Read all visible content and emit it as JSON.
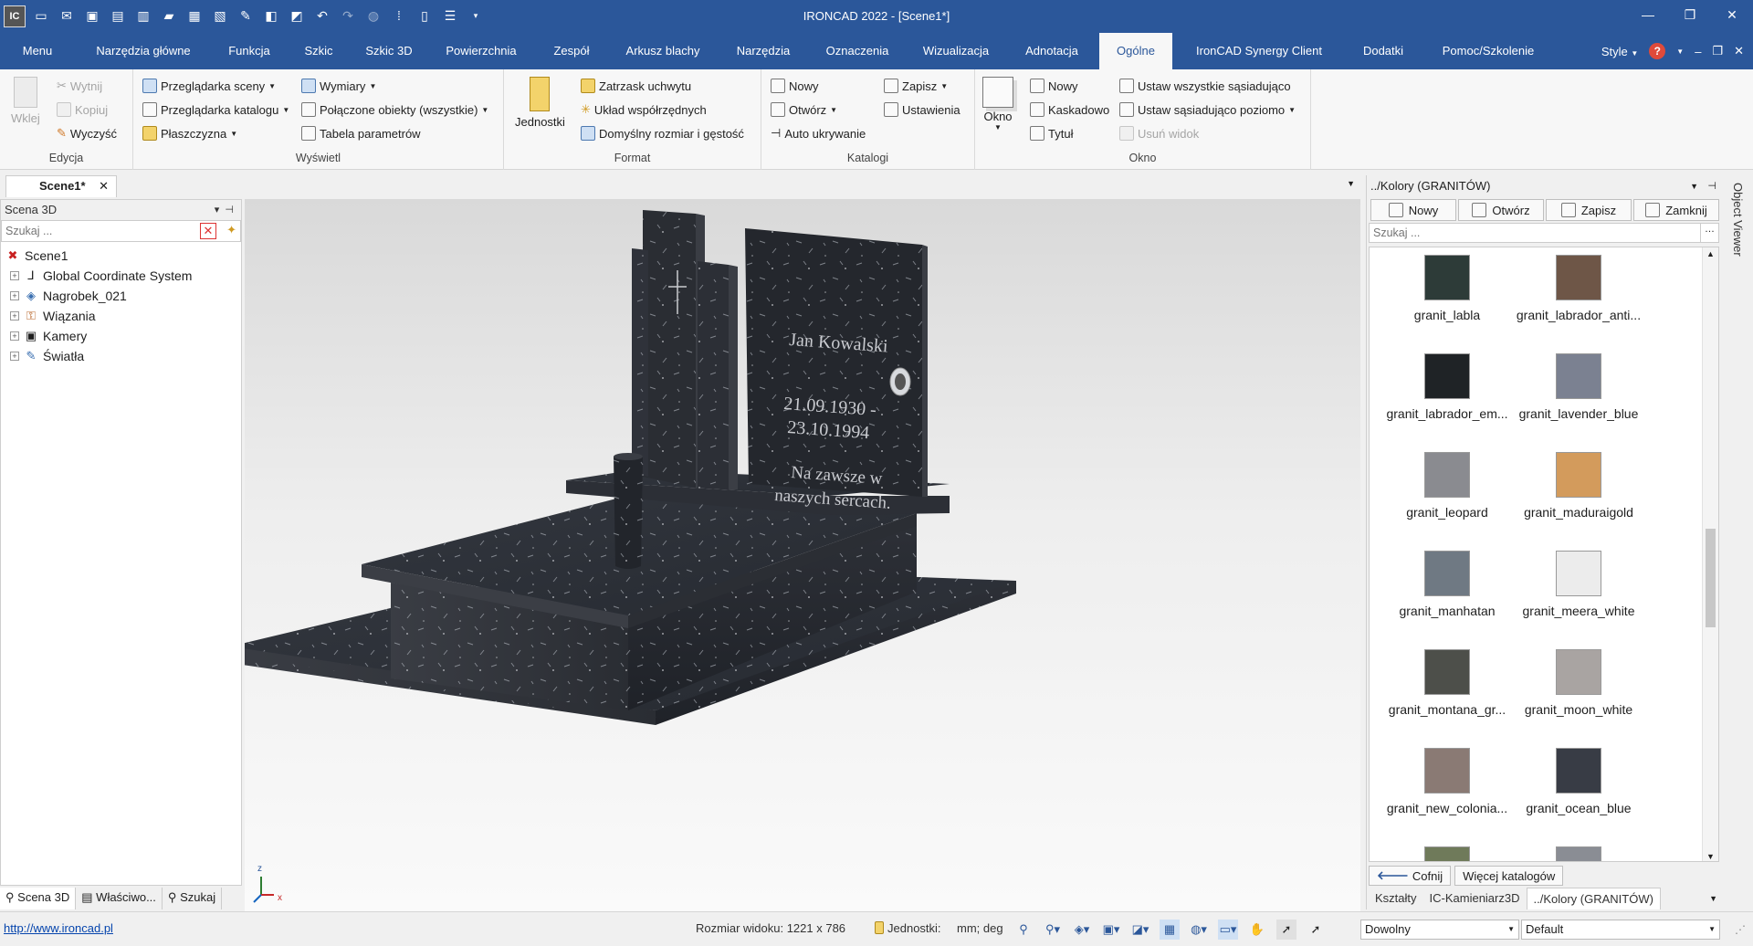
{
  "window": {
    "title": "IRONCAD 2022 - [Scene1*]",
    "logo": "IC",
    "controls": [
      "—",
      "❐",
      "✕"
    ]
  },
  "qat_icons": [
    "new-icon",
    "open-mail-icon",
    "pdf-icon",
    "export-icon",
    "import-icon",
    "folder-icon",
    "save-icon",
    "save-as-icon",
    "wizard-icon",
    "part-icon",
    "paste-icon",
    "undo-icon",
    "redo-icon",
    "globe-icon",
    "grid-icon",
    "panel-icon",
    "layout-icon",
    "more-icon"
  ],
  "menu": {
    "tabs": [
      "Menu",
      "Narzędzia główne",
      "Funkcja",
      "Szkic",
      "Szkic 3D",
      "Powierzchnia",
      "Zespół",
      "Arkusz blachy",
      "Narzędzia",
      "Oznaczenia",
      "Wizualizacja",
      "Adnotacja",
      "Ogólne",
      "IronCAD Synergy Client",
      "Dodatki",
      "Pomoc/Szkolenie"
    ],
    "active": "Ogólne",
    "style_label": "Style",
    "help_glyph": "?"
  },
  "ribbon": {
    "edycja": {
      "label": "Edycja",
      "paste": "Wklej",
      "cut": "Wytnij",
      "copy": "Kopiuj",
      "clear": "Wyczyść"
    },
    "wyswietl": {
      "label": "Wyświetl",
      "scene_browser": "Przeglądarka sceny",
      "catalog_browser": "Przeglądarka katalogu",
      "plane": "Płaszczyzna",
      "dimensions": "Wymiary",
      "linked_objects": "Połączone obiekty (wszystkie)",
      "param_table": "Tabela parametrów"
    },
    "format": {
      "label": "Format",
      "units": "Jednostki",
      "snap": "Zatrzask uchwytu",
      "coord": "Układ współrzędnych",
      "default_size": "Domyślny rozmiar i gęstość"
    },
    "katalogi": {
      "label": "Katalogi",
      "new": "Nowy",
      "open": "Otwórz",
      "autohide": "Auto ukrywanie",
      "save": "Zapisz",
      "settings": "Ustawienia"
    },
    "okno": {
      "label": "Okno",
      "window": "Okno",
      "new": "Nowy",
      "cascade": "Kaskadowo",
      "title": "Tytuł",
      "tile_all": "Ustaw wszystkie sąsiadująco",
      "tile_h": "Ustaw sąsiadująco poziomo",
      "remove_view": "Usuń widok"
    }
  },
  "document": {
    "tab": "Scene1*",
    "close": "✕"
  },
  "scene_tree": {
    "header": "Scena 3D",
    "search_placeholder": "Szukaj ...",
    "items": [
      {
        "label": "Scene1",
        "icon": "scene-icon",
        "root": true
      },
      {
        "label": "Global Coordinate System",
        "icon": "axes-icon"
      },
      {
        "label": "Nagrobek_021",
        "icon": "assembly-icon"
      },
      {
        "label": "Wiązania",
        "icon": "constraints-icon"
      },
      {
        "label": "Kamery",
        "icon": "camera-icon"
      },
      {
        "label": "Światła",
        "icon": "light-icon"
      }
    ],
    "bottom_tabs": [
      "Scena 3D",
      "Właściwo...",
      "Szukaj"
    ]
  },
  "viewport": {
    "inscription": {
      "name": "Jan Kowalski",
      "born": "21.09.1930 -",
      "died": "23.10.1994",
      "line1": "Na zawsze w",
      "line2": "naszych sercach."
    },
    "axis_z": "z",
    "axis_x": "x"
  },
  "catalog": {
    "header": "../Kolory (GRANITÓW)",
    "buttons": [
      "Nowy",
      "Otwórz",
      "Zapisz",
      "Zamknij"
    ],
    "search_placeholder": "Szukaj ...",
    "items": [
      {
        "name": "granit_labla",
        "color": "#2d3b38"
      },
      {
        "name": "granit_labrador_anti...",
        "color": "#6e5647"
      },
      {
        "name": "granit_labrador_em...",
        "color": "#1f2326"
      },
      {
        "name": "granit_lavender_blue",
        "color": "#7b8191"
      },
      {
        "name": "granit_leopard",
        "color": "#8a8b90"
      },
      {
        "name": "granit_maduraigold",
        "color": "#d39b5c"
      },
      {
        "name": "granit_manhatan",
        "color": "#6f7983"
      },
      {
        "name": "granit_meera_white",
        "color": "#ececec"
      },
      {
        "name": "granit_montana_gr...",
        "color": "#4d4f4a"
      },
      {
        "name": "granit_moon_white",
        "color": "#a9a4a2"
      },
      {
        "name": "granit_new_colonia...",
        "color": "#8a7a74"
      },
      {
        "name": "granit_ocean_blue",
        "color": "#383c45"
      }
    ],
    "back": "Cofnij",
    "more": "Więcej katalogów",
    "tabs": [
      "Kształty",
      "IC-Kamieniarz3D",
      "../Kolory (GRANITÓW)"
    ],
    "object_viewer": "Object Viewer"
  },
  "status": {
    "url": "http://www.ironcad.pl",
    "view_size": "Rozmiar widoku: 1221 x  786",
    "units_label": "Jednostki:",
    "units_value": "mm; deg",
    "mode": "Dowolny",
    "preset": "Default"
  }
}
